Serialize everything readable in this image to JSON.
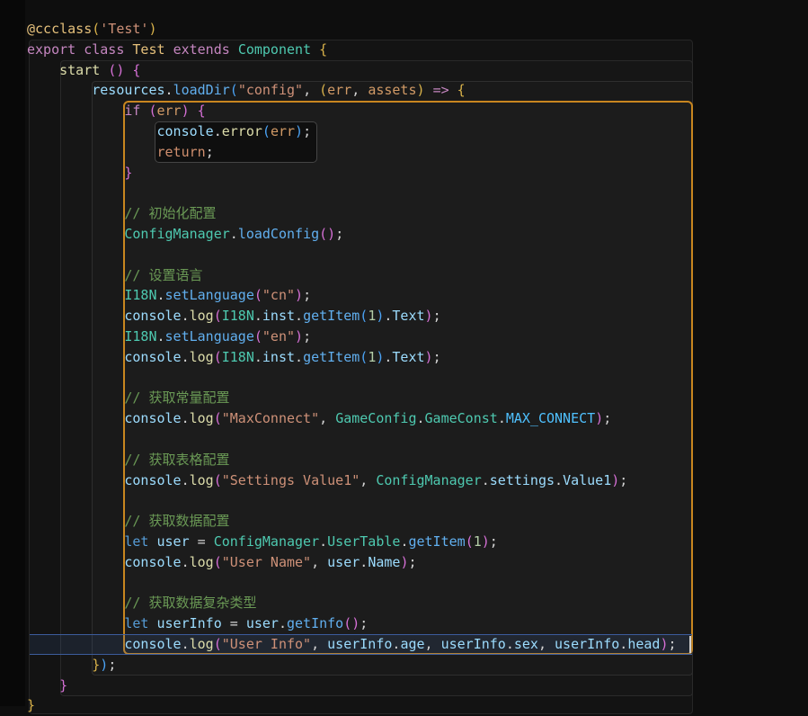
{
  "editor": {
    "background": "#0e0e0e",
    "gutter_color": "#080808",
    "palette": {
      "d": "#d4d4d4",
      "kw": "#c586c0",
      "let": "#569cd6",
      "ret": "#cf8e6d",
      "dec": "#e5c07b",
      "str": "#ce9178",
      "cls": "#4ec9b0",
      "clsy": "#e5c07b",
      "fn": "#61afef",
      "fny": "#dcdcaa",
      "v": "#9cdcfe",
      "pm": "#d19a66",
      "num": "#b5cea8",
      "cm": "#6a9955",
      "const": "#4fc1ff",
      "b1": "#d9b24a",
      "b2": "#d670d6",
      "b3": "#4ba3f5",
      "op": "#d4d4d4",
      "ar": "#c586c0"
    },
    "scopes": {
      "class_body": {
        "bg": "#131313",
        "border": "#262626"
      },
      "start_body": {
        "bg": "#161616",
        "border": "#2a2a2a"
      },
      "callback_call": {
        "bg": "#191919",
        "border": "#2e2e2e"
      },
      "arrow_body": {
        "bg": "#1c1c1c",
        "border": "#c8861f"
      },
      "if_body": {
        "bg": "#0f0f0f",
        "border": "#454545"
      }
    },
    "current_line": {
      "line_number": 31,
      "bg": "rgba(64,100,160,0.16)",
      "border": "#3c5c9c"
    },
    "code": {
      "lines": [
        [
          [
            "@ccclass",
            "dec"
          ],
          [
            "(",
            "b1"
          ],
          [
            "'Test'",
            "str"
          ],
          [
            ")",
            "b1"
          ]
        ],
        [
          [
            "export",
            "kw"
          ],
          [
            " ",
            "d"
          ],
          [
            "class",
            "kw"
          ],
          [
            " ",
            "d"
          ],
          [
            "Test",
            "clsy"
          ],
          [
            " ",
            "d"
          ],
          [
            "extends",
            "kw"
          ],
          [
            " ",
            "d"
          ],
          [
            "Component",
            "cls"
          ],
          [
            " ",
            "d"
          ],
          [
            "{",
            "b1"
          ]
        ],
        [
          [
            "    ",
            "d"
          ],
          [
            "start",
            "fny"
          ],
          [
            " ",
            "d"
          ],
          [
            "(",
            "b2"
          ],
          [
            ")",
            "b2"
          ],
          [
            " ",
            "d"
          ],
          [
            "{",
            "b2"
          ]
        ],
        [
          [
            "        ",
            "d"
          ],
          [
            "resources",
            "v"
          ],
          [
            ".",
            "op"
          ],
          [
            "loadDir",
            "fn"
          ],
          [
            "(",
            "b3"
          ],
          [
            "\"config\"",
            "str"
          ],
          [
            ",",
            "op"
          ],
          [
            " ",
            "d"
          ],
          [
            "(",
            "b1"
          ],
          [
            "err",
            "pm"
          ],
          [
            ",",
            "op"
          ],
          [
            " ",
            "d"
          ],
          [
            "assets",
            "pm"
          ],
          [
            ")",
            "b1"
          ],
          [
            " ",
            "d"
          ],
          [
            "=>",
            "ar"
          ],
          [
            " ",
            "d"
          ],
          [
            "{",
            "b1"
          ]
        ],
        [
          [
            "            ",
            "d"
          ],
          [
            "if",
            "kw"
          ],
          [
            " ",
            "d"
          ],
          [
            "(",
            "b2"
          ],
          [
            "err",
            "pm"
          ],
          [
            ")",
            "b2"
          ],
          [
            " ",
            "d"
          ],
          [
            "{",
            "b2"
          ]
        ],
        [
          [
            "                ",
            "d"
          ],
          [
            "console",
            "v"
          ],
          [
            ".",
            "op"
          ],
          [
            "error",
            "fny"
          ],
          [
            "(",
            "b3"
          ],
          [
            "err",
            "pm"
          ],
          [
            ")",
            "b3"
          ],
          [
            ";",
            "op"
          ]
        ],
        [
          [
            "                ",
            "d"
          ],
          [
            "return",
            "ret"
          ],
          [
            ";",
            "op"
          ]
        ],
        [
          [
            "            ",
            "d"
          ],
          [
            "}",
            "b2"
          ]
        ],
        [],
        [
          [
            "            ",
            "d"
          ],
          [
            "// 初始化配置",
            "cm"
          ]
        ],
        [
          [
            "            ",
            "d"
          ],
          [
            "ConfigManager",
            "cls"
          ],
          [
            ".",
            "op"
          ],
          [
            "loadConfig",
            "fn"
          ],
          [
            "(",
            "b2"
          ],
          [
            ")",
            "b2"
          ],
          [
            ";",
            "op"
          ]
        ],
        [],
        [
          [
            "            ",
            "d"
          ],
          [
            "// 设置语言",
            "cm"
          ]
        ],
        [
          [
            "            ",
            "d"
          ],
          [
            "I18N",
            "cls"
          ],
          [
            ".",
            "op"
          ],
          [
            "setLanguage",
            "fn"
          ],
          [
            "(",
            "b2"
          ],
          [
            "\"cn\"",
            "str"
          ],
          [
            ")",
            "b2"
          ],
          [
            ";",
            "op"
          ]
        ],
        [
          [
            "            ",
            "d"
          ],
          [
            "console",
            "v"
          ],
          [
            ".",
            "op"
          ],
          [
            "log",
            "fny"
          ],
          [
            "(",
            "b2"
          ],
          [
            "I18N",
            "cls"
          ],
          [
            ".",
            "op"
          ],
          [
            "inst",
            "v"
          ],
          [
            ".",
            "op"
          ],
          [
            "getItem",
            "fn"
          ],
          [
            "(",
            "b3"
          ],
          [
            "1",
            "num"
          ],
          [
            ")",
            "b3"
          ],
          [
            ".",
            "op"
          ],
          [
            "Text",
            "v"
          ],
          [
            ")",
            "b2"
          ],
          [
            ";",
            "op"
          ]
        ],
        [
          [
            "            ",
            "d"
          ],
          [
            "I18N",
            "cls"
          ],
          [
            ".",
            "op"
          ],
          [
            "setLanguage",
            "fn"
          ],
          [
            "(",
            "b2"
          ],
          [
            "\"en\"",
            "str"
          ],
          [
            ")",
            "b2"
          ],
          [
            ";",
            "op"
          ]
        ],
        [
          [
            "            ",
            "d"
          ],
          [
            "console",
            "v"
          ],
          [
            ".",
            "op"
          ],
          [
            "log",
            "fny"
          ],
          [
            "(",
            "b2"
          ],
          [
            "I18N",
            "cls"
          ],
          [
            ".",
            "op"
          ],
          [
            "inst",
            "v"
          ],
          [
            ".",
            "op"
          ],
          [
            "getItem",
            "fn"
          ],
          [
            "(",
            "b3"
          ],
          [
            "1",
            "num"
          ],
          [
            ")",
            "b3"
          ],
          [
            ".",
            "op"
          ],
          [
            "Text",
            "v"
          ],
          [
            ")",
            "b2"
          ],
          [
            ";",
            "op"
          ]
        ],
        [],
        [
          [
            "            ",
            "d"
          ],
          [
            "// 获取常量配置",
            "cm"
          ]
        ],
        [
          [
            "            ",
            "d"
          ],
          [
            "console",
            "v"
          ],
          [
            ".",
            "op"
          ],
          [
            "log",
            "fny"
          ],
          [
            "(",
            "b2"
          ],
          [
            "\"MaxConnect\"",
            "str"
          ],
          [
            ",",
            "op"
          ],
          [
            " ",
            "d"
          ],
          [
            "GameConfig",
            "cls"
          ],
          [
            ".",
            "op"
          ],
          [
            "GameConst",
            "cls"
          ],
          [
            ".",
            "op"
          ],
          [
            "MAX_CONNECT",
            "const"
          ],
          [
            ")",
            "b2"
          ],
          [
            ";",
            "op"
          ]
        ],
        [],
        [
          [
            "            ",
            "d"
          ],
          [
            "// 获取表格配置",
            "cm"
          ]
        ],
        [
          [
            "            ",
            "d"
          ],
          [
            "console",
            "v"
          ],
          [
            ".",
            "op"
          ],
          [
            "log",
            "fny"
          ],
          [
            "(",
            "b2"
          ],
          [
            "\"Settings Value1\"",
            "str"
          ],
          [
            ",",
            "op"
          ],
          [
            " ",
            "d"
          ],
          [
            "ConfigManager",
            "cls"
          ],
          [
            ".",
            "op"
          ],
          [
            "settings",
            "v"
          ],
          [
            ".",
            "op"
          ],
          [
            "Value1",
            "v"
          ],
          [
            ")",
            "b2"
          ],
          [
            ";",
            "op"
          ]
        ],
        [],
        [
          [
            "            ",
            "d"
          ],
          [
            "// 获取数据配置",
            "cm"
          ]
        ],
        [
          [
            "            ",
            "d"
          ],
          [
            "let",
            "let"
          ],
          [
            " ",
            "d"
          ],
          [
            "user",
            "v"
          ],
          [
            " ",
            "d"
          ],
          [
            "=",
            "op"
          ],
          [
            " ",
            "d"
          ],
          [
            "ConfigManager",
            "cls"
          ],
          [
            ".",
            "op"
          ],
          [
            "UserTable",
            "cls"
          ],
          [
            ".",
            "op"
          ],
          [
            "getItem",
            "fn"
          ],
          [
            "(",
            "b2"
          ],
          [
            "1",
            "num"
          ],
          [
            ")",
            "b2"
          ],
          [
            ";",
            "op"
          ]
        ],
        [
          [
            "            ",
            "d"
          ],
          [
            "console",
            "v"
          ],
          [
            ".",
            "op"
          ],
          [
            "log",
            "fny"
          ],
          [
            "(",
            "b2"
          ],
          [
            "\"User Name\"",
            "str"
          ],
          [
            ",",
            "op"
          ],
          [
            " ",
            "d"
          ],
          [
            "user",
            "v"
          ],
          [
            ".",
            "op"
          ],
          [
            "Name",
            "v"
          ],
          [
            ")",
            "b2"
          ],
          [
            ";",
            "op"
          ]
        ],
        [],
        [
          [
            "            ",
            "d"
          ],
          [
            "// 获取数据复杂类型",
            "cm"
          ]
        ],
        [
          [
            "            ",
            "d"
          ],
          [
            "let",
            "let"
          ],
          [
            " ",
            "d"
          ],
          [
            "userInfo",
            "v"
          ],
          [
            " ",
            "d"
          ],
          [
            "=",
            "op"
          ],
          [
            " ",
            "d"
          ],
          [
            "user",
            "v"
          ],
          [
            ".",
            "op"
          ],
          [
            "getInfo",
            "fn"
          ],
          [
            "(",
            "b2"
          ],
          [
            ")",
            "b2"
          ],
          [
            ";",
            "op"
          ]
        ],
        [
          [
            "            ",
            "d"
          ],
          [
            "console",
            "v"
          ],
          [
            ".",
            "op"
          ],
          [
            "log",
            "fny"
          ],
          [
            "(",
            "b2"
          ],
          [
            "\"User Info\"",
            "str"
          ],
          [
            ",",
            "op"
          ],
          [
            " ",
            "d"
          ],
          [
            "userInfo",
            "v"
          ],
          [
            ".",
            "op"
          ],
          [
            "age",
            "v"
          ],
          [
            ",",
            "op"
          ],
          [
            " ",
            "d"
          ],
          [
            "userInfo",
            "v"
          ],
          [
            ".",
            "op"
          ],
          [
            "sex",
            "v"
          ],
          [
            ",",
            "op"
          ],
          [
            " ",
            "d"
          ],
          [
            "userInfo",
            "v"
          ],
          [
            ".",
            "op"
          ],
          [
            "head",
            "v"
          ],
          [
            ")",
            "b2"
          ],
          [
            ";",
            "op"
          ]
        ],
        [
          [
            "        ",
            "d"
          ],
          [
            "}",
            "b1"
          ],
          [
            ")",
            "b3"
          ],
          [
            ";",
            "op"
          ]
        ],
        [
          [
            "    ",
            "d"
          ],
          [
            "}",
            "b2"
          ]
        ],
        [
          [
            "}",
            "b1"
          ]
        ]
      ]
    }
  }
}
